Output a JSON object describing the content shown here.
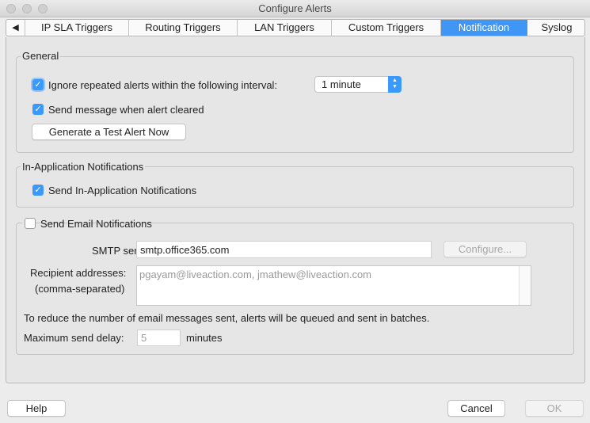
{
  "window": {
    "title": "Configure Alerts"
  },
  "tabs": {
    "scroll_left_icon": "◀",
    "items": [
      {
        "label": "IP SLA Triggers"
      },
      {
        "label": "Routing Triggers"
      },
      {
        "label": "LAN Triggers"
      },
      {
        "label": "Custom Triggers"
      },
      {
        "label": "Notification",
        "selected": true
      },
      {
        "label": "Syslog"
      }
    ]
  },
  "general": {
    "title": "General",
    "ignore_repeated": {
      "label": "Ignore repeated alerts within the following interval:",
      "checked": true
    },
    "interval": {
      "value": "1 minute"
    },
    "send_cleared": {
      "label": "Send message when alert cleared",
      "checked": true
    },
    "test_button": "Generate a Test Alert Now"
  },
  "in_app": {
    "title": "In-Application Notifications",
    "send": {
      "label": "Send In-Application Notifications",
      "checked": true
    }
  },
  "email": {
    "title": "Send Email Notifications",
    "checked": false,
    "smtp_label": "SMTP server:",
    "smtp_value": "smtp.office365.com",
    "configure_button": "Configure...",
    "recipients_label_1": "Recipient addresses:",
    "recipients_label_2": "(comma-separated)",
    "recipients_value": "pgayam@liveaction.com, jmathew@liveaction.com",
    "batch_note": "To reduce the number of email messages sent, alerts will be queued and sent in batches.",
    "delay_label": "Maximum send delay:",
    "delay_value": "5",
    "delay_unit": "minutes"
  },
  "footer": {
    "help_button": "Help",
    "cancel_button": "Cancel",
    "ok_button": "OK"
  },
  "colors": {
    "accent": "#3b99fc",
    "tab_selected": "#3f96f5"
  }
}
